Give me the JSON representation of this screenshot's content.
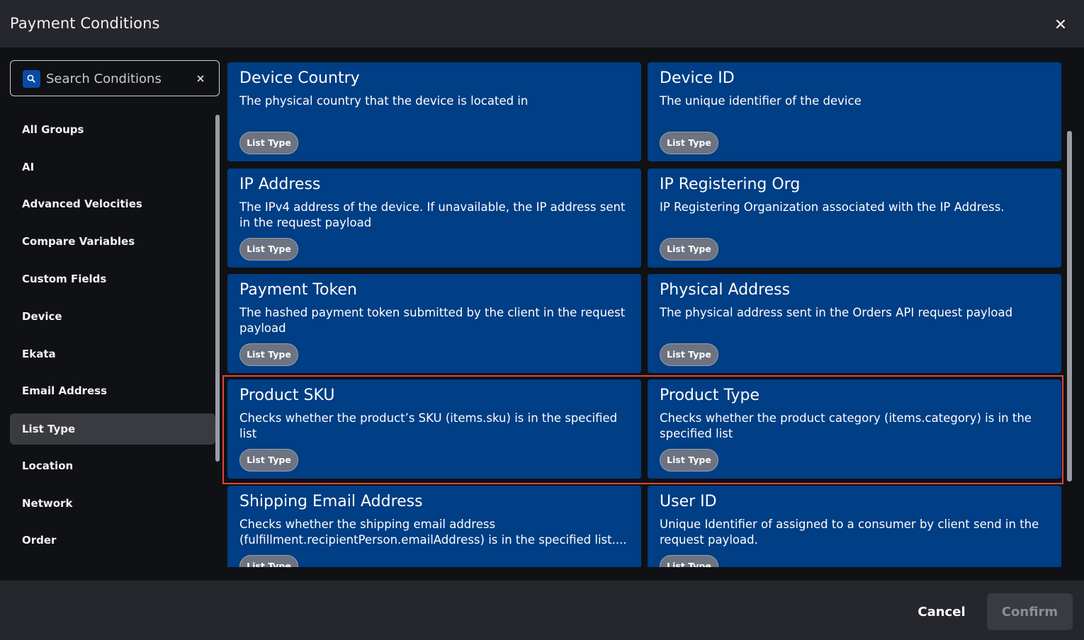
{
  "dialog": {
    "title": "Payment Conditions",
    "close_icon": "close-icon"
  },
  "search": {
    "placeholder": "Search Conditions",
    "value": "",
    "icon": "search-icon",
    "clear_icon": "clear-icon"
  },
  "sidebar": {
    "active": "List Type",
    "items": [
      {
        "label": "All Groups"
      },
      {
        "label": "AI"
      },
      {
        "label": "Advanced Velocities"
      },
      {
        "label": "Compare Variables"
      },
      {
        "label": "Custom Fields"
      },
      {
        "label": "Device"
      },
      {
        "label": "Ekata"
      },
      {
        "label": "Email Address"
      },
      {
        "label": "List Type"
      },
      {
        "label": "Location"
      },
      {
        "label": "Network"
      },
      {
        "label": "Order"
      }
    ]
  },
  "cards": [
    {
      "title": "Device Country",
      "description": "The physical country that the device is located in",
      "badge": "List Type"
    },
    {
      "title": "Device ID",
      "description": "The unique identifier of the device",
      "badge": "List Type"
    },
    {
      "title": "IP Address",
      "description": "The IPv4 address of the device. If unavailable, the IP address sent in the request payload",
      "badge": "List Type"
    },
    {
      "title": "IP Registering Org",
      "description": "IP Registering Organization associated with the IP Address.",
      "badge": "List Type"
    },
    {
      "title": "Payment Token",
      "description": "The hashed payment token submitted by the client in the request payload",
      "badge": "List Type"
    },
    {
      "title": "Physical Address",
      "description": "The physical address sent in the Orders API request payload",
      "badge": "List Type"
    },
    {
      "title": "Product SKU",
      "description": "Checks whether the product’s SKU (items.sku) is in the specified list",
      "badge": "List Type"
    },
    {
      "title": "Product Type",
      "description": "Checks whether the product category (items.category) is in the specified list",
      "badge": "List Type"
    },
    {
      "title": "Shipping Email Address",
      "description": "Checks whether the shipping email address (fulfillment.recipientPerson.emailAddress) is in the specified list....",
      "badge": "List Type"
    },
    {
      "title": "User ID",
      "description": "Unique Identifier of assigned to a consumer by client send in the request payload.",
      "badge": "List Type"
    }
  ],
  "footer": {
    "cancel_label": "Cancel",
    "confirm_label": "Confirm"
  },
  "colors": {
    "card_bg": "#003e85",
    "highlight": "#e0453f",
    "active_item_bg": "#3a3b41",
    "header_bg": "#26272d"
  }
}
